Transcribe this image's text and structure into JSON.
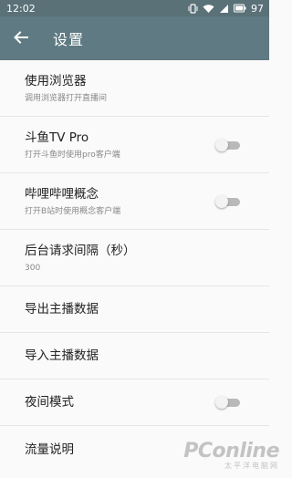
{
  "status_bar": {
    "time": "12:02",
    "battery": "97"
  },
  "app_bar": {
    "title": "设置",
    "back_icon": "back-arrow-icon"
  },
  "settings": [
    {
      "title": "使用浏览器",
      "subtitle": "调用浏览器打开直播间",
      "has_switch": false
    },
    {
      "title": "斗鱼TV Pro",
      "subtitle": "打开斗鱼时使用pro客户端",
      "has_switch": true,
      "checked": false
    },
    {
      "title": "哔哩哔哩概念",
      "subtitle": "打开B站时使用概念客户端",
      "has_switch": true,
      "checked": false
    },
    {
      "title": "后台请求间隔（秒）",
      "subtitle": "300",
      "has_switch": false
    },
    {
      "title": "导出主播数据",
      "has_switch": false
    },
    {
      "title": "导入主播数据",
      "has_switch": false
    },
    {
      "title": "夜间模式",
      "has_switch": true,
      "checked": false
    },
    {
      "title": "流量说明",
      "has_switch": false
    }
  ],
  "watermark": {
    "brand": "PConline",
    "tagline": "太平洋电脑网"
  },
  "colors": {
    "status_bar": "#5a7178",
    "app_bar": "#5f7a82",
    "switch_track_off": "#b9b9b9"
  }
}
